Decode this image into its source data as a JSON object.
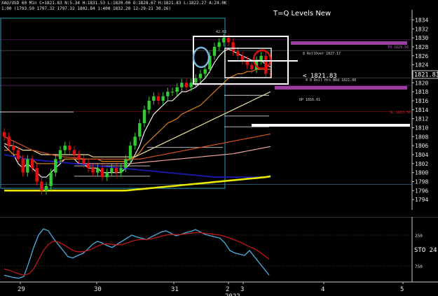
{
  "header": {
    "line1": "XAU/USD 60 Min  C=1821.83  N:5.34  H:1831.53  L:1820.00  O:1828.67  H:1821.83  L:1822.27  A:24.0K",
    "line2": "1:00  (1793.59  1797.32  1797.32  1802.84  1:400  1832.20  12-29-21  30.26)"
  },
  "title": "T=Q Levels New",
  "colors": {
    "background": "#000000",
    "candle_up": "#33cc33",
    "candle_down": "#e01010",
    "blue_circle": "#7ab8e0",
    "red_circle": "#e01010",
    "magenta_bar": "#9b3fa0",
    "yellow_ma": "#e8e800",
    "blue_ma": "#1a1ab0",
    "stoch_fast": "#4ab0e0",
    "stoch_slow": "#c01818"
  },
  "chart_data": [
    {
      "type": "candlestick",
      "title": "T=Q Levels New",
      "x_labels": [
        "29",
        "30",
        "31",
        "2",
        "3",
        "4",
        "5"
      ],
      "x_sub_label": "2022",
      "y_ticks": [
        1794,
        1796,
        1798,
        1800,
        1802,
        1804,
        1806,
        1808,
        1810,
        1812,
        1814,
        1816,
        1818,
        1820,
        1822,
        1824,
        1826,
        1828,
        1830,
        1832,
        1834
      ],
      "ylim": [
        1792,
        1835
      ],
      "last_price": "1821.83",
      "annotations": [
        {
          "text": "8 RollOver 1827.17",
          "price": 1827.17
        },
        {
          "text": "< 1821.83",
          "price": 1821.83
        },
        {
          "text": "4 8 Roll Hrs BRd 1821.06",
          "price": 1821.06
        },
        {
          "text": "OP 1816.01",
          "price": 1816.01
        },
        {
          "text": "TH 1829.58",
          "price": 1829.58
        },
        {
          "text": "SL 1813.56",
          "price": 1813.56
        },
        {
          "text": "42.03",
          "price": 1833.0
        }
      ],
      "closes": [
        1808,
        1806,
        1805,
        1803,
        1800,
        1803,
        1801,
        1798,
        1796,
        1797,
        1800,
        1803,
        1805,
        1806,
        1805,
        1804,
        1803,
        1802,
        1801,
        1800,
        1801,
        1799,
        1800,
        1801,
        1800,
        1801,
        1803,
        1806,
        1808,
        1811,
        1814,
        1816,
        1817,
        1816,
        1817,
        1818,
        1818,
        1819,
        1820,
        1819,
        1820,
        1821,
        1822,
        1823,
        1826,
        1828,
        1829,
        1830,
        1829,
        1827,
        1826,
        1825,
        1824,
        1823,
        1825,
        1826,
        1822,
        1821.83
      ],
      "series": [
        {
          "name": "MA fast",
          "values": [
            1806,
            1805,
            1804,
            1802,
            1801,
            1802,
            1801,
            1800,
            1799,
            1799,
            1800,
            1801,
            1802,
            1803,
            1803,
            1803,
            1802,
            1802,
            1801,
            1801,
            1801,
            1800,
            1800,
            1800,
            1800,
            1800,
            1801,
            1802,
            1804,
            1806,
            1809,
            1811,
            1813,
            1814,
            1815,
            1816,
            1816,
            1817,
            1818,
            1818,
            1818.5,
            1819,
            1820,
            1821,
            1822.5,
            1824.5,
            1826,
            1827,
            1827.5,
            1827,
            1826.5,
            1826,
            1825.5,
            1825,
            1825,
            1825,
            1824,
            1823.5
          ]
        },
        {
          "name": "MA orange",
          "values": [
            1805,
            1805,
            1804,
            1804,
            1803,
            1803,
            1803,
            1802,
            1802,
            1802,
            1802,
            1802,
            1802.5,
            1803,
            1803,
            1803,
            1803,
            1803,
            1803,
            1803,
            1803,
            1802.5,
            1802.5,
            1802.5,
            1802.5,
            1802.5,
            1802.5,
            1803,
            1803.5,
            1804.5,
            1806,
            1807,
            1808,
            1809,
            1810,
            1811,
            1811.5,
            1812,
            1813,
            1813.5,
            1814,
            1814.5,
            1815,
            1816,
            1817,
            1818,
            1819,
            1820,
            1821,
            1821.5,
            1822,
            1822,
            1822.5,
            1822.5,
            1823,
            1823,
            1823,
            1823
          ]
        },
        {
          "name": "MA light yellow",
          "values": [
            1806.5,
            1806,
            1806,
            1805.5,
            1805,
            1805,
            1805,
            1804.5,
            1804,
            1804,
            1804,
            1804,
            1804,
            1804,
            1804,
            1804,
            1804,
            1804,
            1804,
            1803.5,
            1803.5,
            1803.5,
            1803.5,
            1803.5,
            1803.5,
            1803.5,
            1803.5,
            1803.5,
            1803.5,
            1804,
            1804.5,
            1805,
            1805.5,
            1806,
            1806.5,
            1807,
            1807.5,
            1808,
            1808.5,
            1809,
            1809.5,
            1810,
            1810.5,
            1811,
            1811.5,
            1812,
            1812.5,
            1813,
            1813.5,
            1814,
            1814.5,
            1815,
            1815.5,
            1816,
            1816.5,
            1817,
            1817.5,
            1818
          ]
        },
        {
          "name": "MA dark orange",
          "values": [
            1808,
            1807.5,
            1807,
            1806.5,
            1806,
            1805.5,
            1805,
            1804.8,
            1804.5,
            1804.3,
            1804,
            1803.8,
            1803.6,
            1803.5,
            1803.4,
            1803.3,
            1803.2,
            1803.1,
            1803,
            1803,
            1803,
            1803,
            1803,
            1803,
            1803,
            1803,
            1803,
            1803,
            1803,
            1803,
            1803.2,
            1803.4,
            1803.6,
            1803.8,
            1804,
            1804.2,
            1804.4,
            1804.6,
            1804.8,
            1805,
            1805.2,
            1805.4,
            1805.6,
            1805.8,
            1806,
            1806.2,
            1806.4,
            1806.6,
            1806.8,
            1807,
            1807.2,
            1807.4,
            1807.6,
            1807.8,
            1808,
            1808.2,
            1808.4,
            1808.6
          ]
        },
        {
          "name": "MA pink",
          "values": [
            1804,
            1803.8,
            1803.6,
            1803.4,
            1803.2,
            1803,
            1802.9,
            1802.8,
            1802.7,
            1802.6,
            1802.5,
            1802.4,
            1802.3,
            1802.2,
            1802.1,
            1802,
            1802,
            1802,
            1802,
            1802,
            1802,
            1802,
            1802,
            1802,
            1802,
            1802,
            1802,
            1802,
            1802.1,
            1802.2,
            1802.3,
            1802.4,
            1802.5,
            1802.6,
            1802.7,
            1802.8,
            1802.9,
            1803,
            1803.1,
            1803.2,
            1803.3,
            1803.4,
            1803.5,
            1803.6,
            1803.7,
            1803.8,
            1803.9,
            1804,
            1804.1,
            1804.2,
            1804.4,
            1804.6,
            1804.8,
            1805,
            1805.2,
            1805.4,
            1805.6,
            1805.8
          ]
        },
        {
          "name": "MA blue",
          "values": [
            1804,
            1803.8,
            1803.6,
            1803.4,
            1803.2,
            1803,
            1802.9,
            1802.8,
            1802.7,
            1802.6,
            1802.5,
            1802.4,
            1802.3,
            1802.2,
            1802.1,
            1802,
            1801.9,
            1801.8,
            1801.7,
            1801.6,
            1801.5,
            1801.4,
            1801.3,
            1801.2,
            1801.1,
            1801,
            1800.9,
            1800.8,
            1800.7,
            1800.6,
            1800.5,
            1800.4,
            1800.3,
            1800.2,
            1800.1,
            1800,
            1799.9,
            1799.8,
            1799.7,
            1799.6,
            1799.5,
            1799.4,
            1799.3,
            1799.2,
            1799.1,
            1799,
            1799,
            1799,
            1799,
            1799,
            1799,
            1799,
            1799,
            1799,
            1799,
            1799,
            1799,
            1799
          ]
        },
        {
          "name": "MA yellow thick",
          "values": [
            1796,
            1796,
            1796,
            1796,
            1796,
            1796,
            1796,
            1796,
            1796,
            1796,
            1796,
            1796,
            1796,
            1796,
            1796,
            1796,
            1796,
            1796,
            1796,
            1796,
            1796,
            1796,
            1796,
            1796,
            1796,
            1796,
            1796,
            1796.1,
            1796.2,
            1796.3,
            1796.4,
            1796.5,
            1796.6,
            1796.7,
            1796.8,
            1796.9,
            1797,
            1797.1,
            1797.2,
            1797.3,
            1797.4,
            1797.5,
            1797.6,
            1797.7,
            1797.8,
            1797.9,
            1798,
            1798.1,
            1798.2,
            1798.3,
            1798.4,
            1798.5,
            1798.6,
            1798.7,
            1798.8,
            1798.9,
            1799,
            1799.2
          ]
        }
      ]
    },
    {
      "type": "line",
      "title": "STO",
      "label": "STO 24.",
      "y_ticks": [
        "250",
        "750"
      ],
      "ylim": [
        0,
        100
      ],
      "series": [
        {
          "name": "STO fast",
          "values": [
            10,
            8,
            6,
            5,
            8,
            30,
            55,
            75,
            85,
            82,
            70,
            60,
            50,
            40,
            38,
            42,
            45,
            52,
            60,
            65,
            62,
            58,
            55,
            60,
            65,
            70,
            75,
            72,
            70,
            68,
            72,
            76,
            80,
            82,
            78,
            74,
            76,
            79,
            81,
            84,
            80,
            76,
            74,
            72,
            70,
            62,
            50,
            46,
            44,
            42,
            50,
            40,
            30,
            20,
            10
          ]
        },
        {
          "name": "STO slow",
          "values": [
            20,
            18,
            15,
            12,
            10,
            12,
            20,
            35,
            50,
            60,
            65,
            64,
            60,
            55,
            50,
            48,
            48,
            50,
            53,
            57,
            60,
            61,
            60,
            59,
            60,
            62,
            65,
            67,
            68,
            68,
            69,
            71,
            73,
            75,
            76,
            76,
            76,
            77,
            78,
            79,
            79,
            78,
            77,
            76,
            75,
            73,
            70,
            67,
            64,
            60,
            56,
            53,
            48,
            42,
            36
          ]
        }
      ]
    }
  ]
}
